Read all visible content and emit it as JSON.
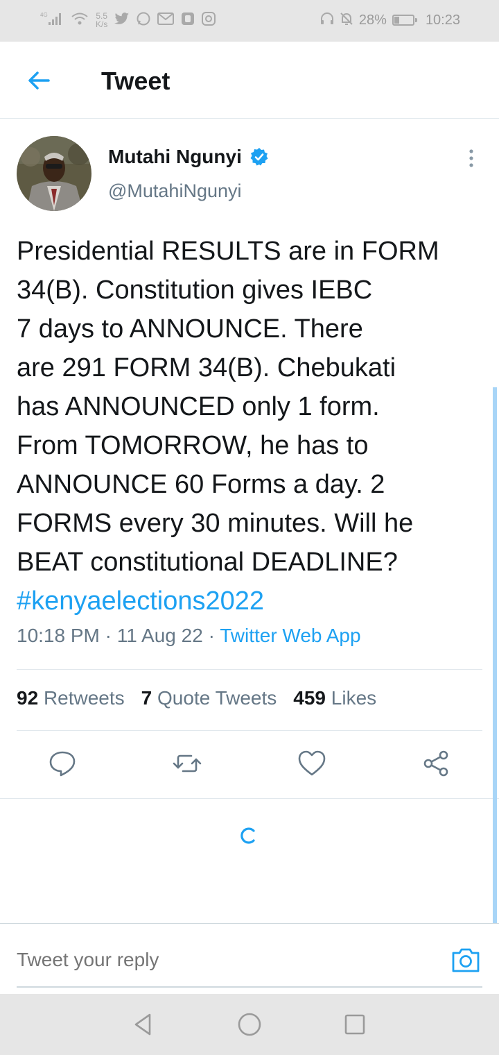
{
  "status_bar": {
    "signal_label": "4G",
    "net_speed_value": "5.5",
    "net_speed_unit": "K/s",
    "battery_percent": "28%",
    "battery_level": 0.28,
    "time": "10:23",
    "icons": [
      "signal-icon",
      "wifi-icon",
      "twitter-icon",
      "whatsapp-icon",
      "gmail-icon",
      "app-icon",
      "instagram-icon",
      "headphones-icon",
      "mute-icon",
      "battery-icon"
    ]
  },
  "header": {
    "title": "Tweet",
    "back_icon": "arrow-left-icon"
  },
  "tweet": {
    "author_name": "Mutahi Ngunyi",
    "handle": "@MutahiNgunyi",
    "verified": true,
    "text_lines": [
      "Presidential RESULTS are in FORM",
      "34(B). Constitution gives IEBC",
      "7 days to ANNOUNCE. There",
      "are 291 FORM 34(B). Chebukati",
      "has ANNOUNCED only 1 form.",
      "From TOMORROW, he has to",
      "ANNOUNCE 60 Forms a day. 2",
      "FORMS every 30 minutes. Will he",
      "BEAT constitutional DEADLINE?"
    ],
    "hashtag": "#kenyaelections2022",
    "time": "10:18 PM",
    "date": "11 Aug 22",
    "separator": " · ",
    "source": "Twitter Web App"
  },
  "stats": {
    "retweets_count": "92",
    "retweets_label": "Retweets",
    "quotes_count": "7",
    "quotes_label": "Quote Tweets",
    "likes_count": "459",
    "likes_label": "Likes"
  },
  "actions": [
    "reply-icon",
    "retweet-icon",
    "like-icon",
    "share-icon"
  ],
  "reply": {
    "placeholder": "Tweet your reply",
    "camera_icon": "camera-icon"
  },
  "colors": {
    "accent": "#1da1f2",
    "text": "#14171a",
    "secondary": "#657786",
    "divider": "#e1e8ed",
    "system_bar": "#e6e6e6"
  }
}
